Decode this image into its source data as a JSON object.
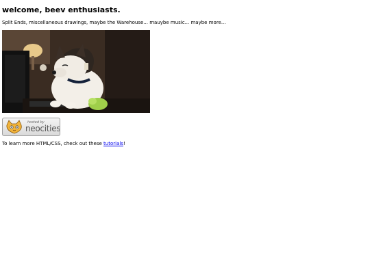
{
  "page": {
    "heading": "welcome, beev enthusiasts.",
    "intro": "Split Ends, miscellaneous drawings, maybe the Warehouse... mauybe music... maybe more...",
    "photo_description_icon": "dog-at-computer-photo",
    "badge": {
      "small_text": "hosted by",
      "big_text": "neocities",
      "icon": "neocities-cat-icon"
    },
    "footer": {
      "text_before": "To learn more HTML/CSS, check out these ",
      "link_label": "tutorials",
      "text_after": "!"
    }
  },
  "colors": {
    "link": "#0000ee",
    "text": "#000000",
    "background": "#ffffff"
  }
}
